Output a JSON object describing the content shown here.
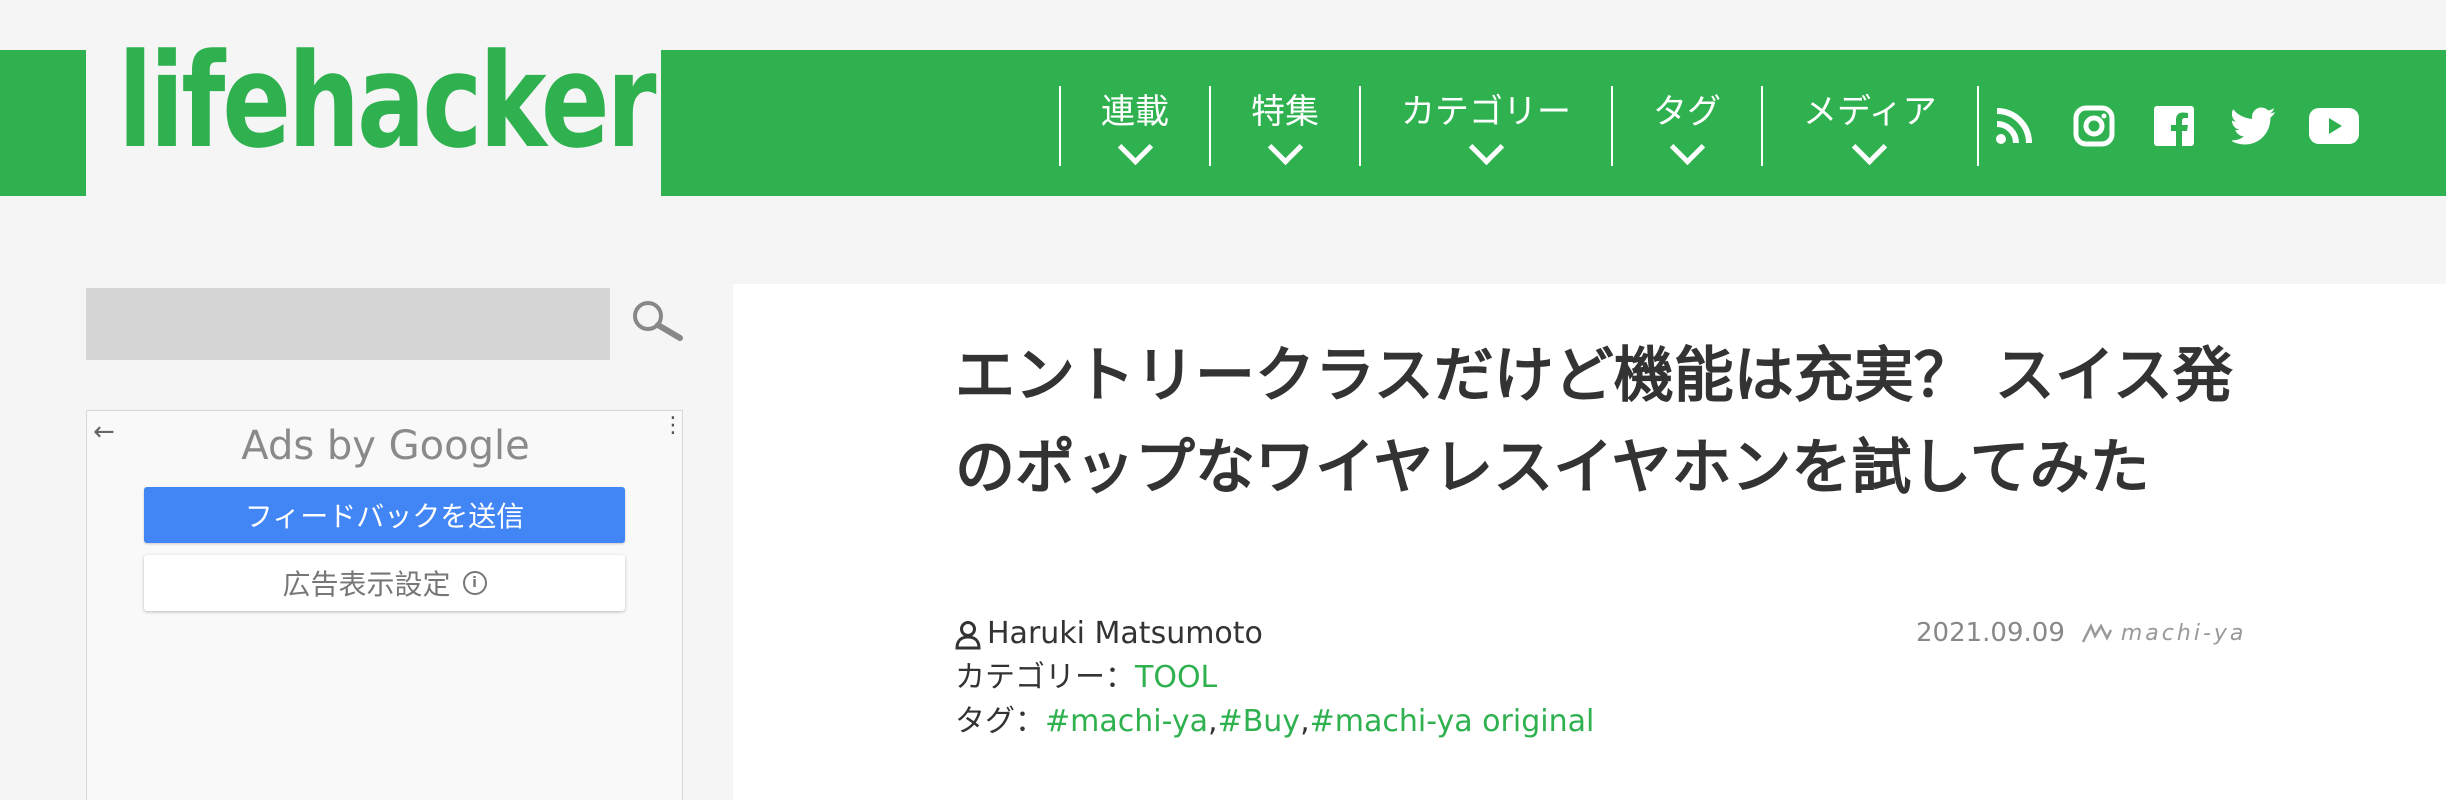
{
  "header": {
    "logo_text": "lifehacker",
    "nav": [
      {
        "label": "連載"
      },
      {
        "label": "特集"
      },
      {
        "label": "カテゴリー"
      },
      {
        "label": "タグ"
      },
      {
        "label": "メディア"
      }
    ],
    "social_icons": [
      "rss-icon",
      "instagram-icon",
      "facebook-icon",
      "twitter-icon",
      "youtube-icon"
    ],
    "brand_color": "#2fb150"
  },
  "sidebar": {
    "search": {
      "placeholder": "",
      "value": ""
    },
    "ad": {
      "title": "Ads by Google",
      "feedback_label": "フィードバックを送信",
      "settings_label": "広告表示設定",
      "button_color": "#4285f4"
    }
  },
  "article": {
    "title": "エントリークラスだけど機能は充実？ スイス発のポップなワイヤレスイヤホンを試してみた",
    "author": "Haruki Matsumoto",
    "category_label": "カテゴリー：",
    "category": "TOOL",
    "tags_label": "タグ：",
    "tags": [
      "#machi-ya",
      "#Buy",
      "#machi-ya original"
    ],
    "tag_separator": ", ",
    "date": "2021.09.09",
    "source_logo": "machi-ya"
  }
}
